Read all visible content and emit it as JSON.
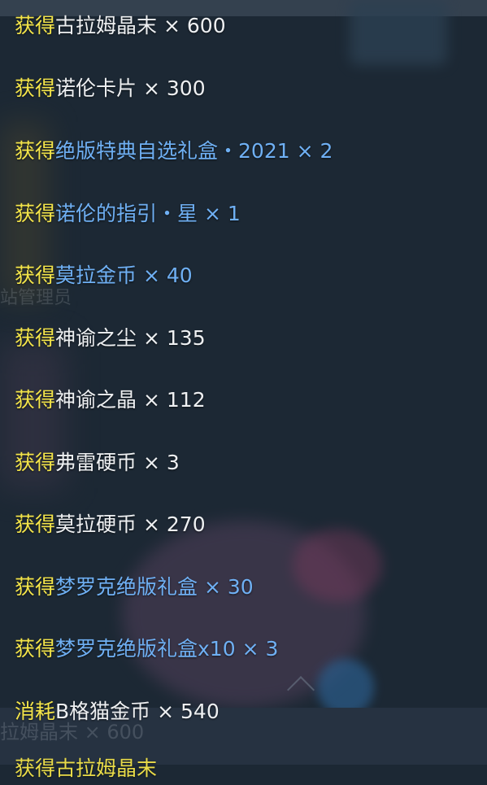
{
  "log": {
    "entries": [
      {
        "verb": "获得",
        "item": "古拉姆晶末",
        "qty": "× 600",
        "tone": "white"
      },
      {
        "verb": "获得",
        "item": "诺伦卡片",
        "qty": "× 300",
        "tone": "white"
      },
      {
        "verb": "获得",
        "item": "绝版特典自选礼盒・2021",
        "qty": "× 2",
        "tone": "blue"
      },
      {
        "verb": "获得",
        "item": "诺伦的指引・星",
        "qty": "× 1",
        "tone": "blue"
      },
      {
        "verb": "获得",
        "item": "莫拉金币",
        "qty": "× 40",
        "tone": "blue"
      },
      {
        "verb": "获得",
        "item": "神谕之尘",
        "qty": "× 135",
        "tone": "white"
      },
      {
        "verb": "获得",
        "item": "神谕之晶",
        "qty": "× 112",
        "tone": "white"
      },
      {
        "verb": "获得",
        "item": "弗雷硬币",
        "qty": "× 3",
        "tone": "white"
      },
      {
        "verb": "获得",
        "item": "莫拉硬币",
        "qty": "× 270",
        "tone": "white"
      },
      {
        "verb": "获得",
        "item": "梦罗克绝版礼盒",
        "qty": "× 30",
        "tone": "blue"
      },
      {
        "verb": "获得",
        "item": "梦罗克绝版礼盒x10",
        "qty": "× 3",
        "tone": "blue"
      },
      {
        "verb": "消耗",
        "item": "B格猫金币",
        "qty": "× 540",
        "tone": "white"
      }
    ],
    "partial_bottom": "获得古拉姆晶末"
  },
  "background": {
    "ghost_text": "拉姆晶末 × 600",
    "faint_text": "站管理员"
  },
  "colors": {
    "verb": "#f4e54a",
    "item_white": "#eef0f2",
    "item_blue": "#6fb0f4",
    "panel_bg": "#1c2834"
  }
}
